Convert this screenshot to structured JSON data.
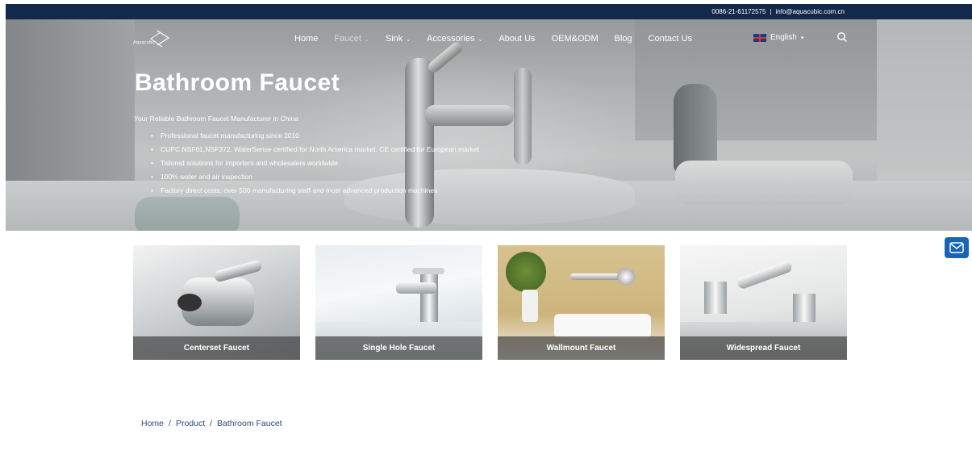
{
  "topbar": {
    "phone": "0086-21-61172575",
    "separator": "|",
    "email": "info@aquacubic.com.cn"
  },
  "logo": {
    "text": "Aquacubic",
    "icon": "logo-mark"
  },
  "nav": {
    "items": [
      {
        "label": "Home",
        "has_dropdown": false
      },
      {
        "label": "Faucet",
        "has_dropdown": true,
        "active": true
      },
      {
        "label": "Sink",
        "has_dropdown": true
      },
      {
        "label": "Accessories",
        "has_dropdown": true
      },
      {
        "label": "About Us",
        "has_dropdown": false
      },
      {
        "label": "OEM&ODM",
        "has_dropdown": false
      },
      {
        "label": "Blog",
        "has_dropdown": false
      },
      {
        "label": "Contact Us",
        "has_dropdown": false
      }
    ],
    "dropdown_caret": "⌄",
    "language": "English",
    "language_caret": "▾",
    "flag_icon": "uk-flag-icon",
    "search_icon": "search-icon"
  },
  "hero": {
    "title": "Bathroom Faucet",
    "subtitle": "Your Reliable Bathroom Faucet Manufacturer in China",
    "bullets": [
      "Professional faucet manufacturing since 2010",
      "CUPC,NSF61,NSF372, WaterSense certified for North America market, CE certified for European market",
      "Tailored solutions for importers and wholesalers worldwide",
      "100% water and air inspection",
      "Factory direct costs, over 500 manufacturing staff and most advanced production machines"
    ]
  },
  "categories": [
    {
      "label": "Centerset Faucet"
    },
    {
      "label": "Single Hole Faucet"
    },
    {
      "label": "Wallmount Faucet"
    },
    {
      "label": "Widespread Faucet"
    }
  ],
  "breadcrumb": {
    "items": [
      "Home",
      "Product",
      "Bathroom Faucet"
    ],
    "separator": "/"
  },
  "floating": {
    "mail_icon": "mail-icon",
    "accent": "#1a64b5"
  },
  "colors": {
    "topbar": "#13294b",
    "link": "#2a4a7a"
  }
}
